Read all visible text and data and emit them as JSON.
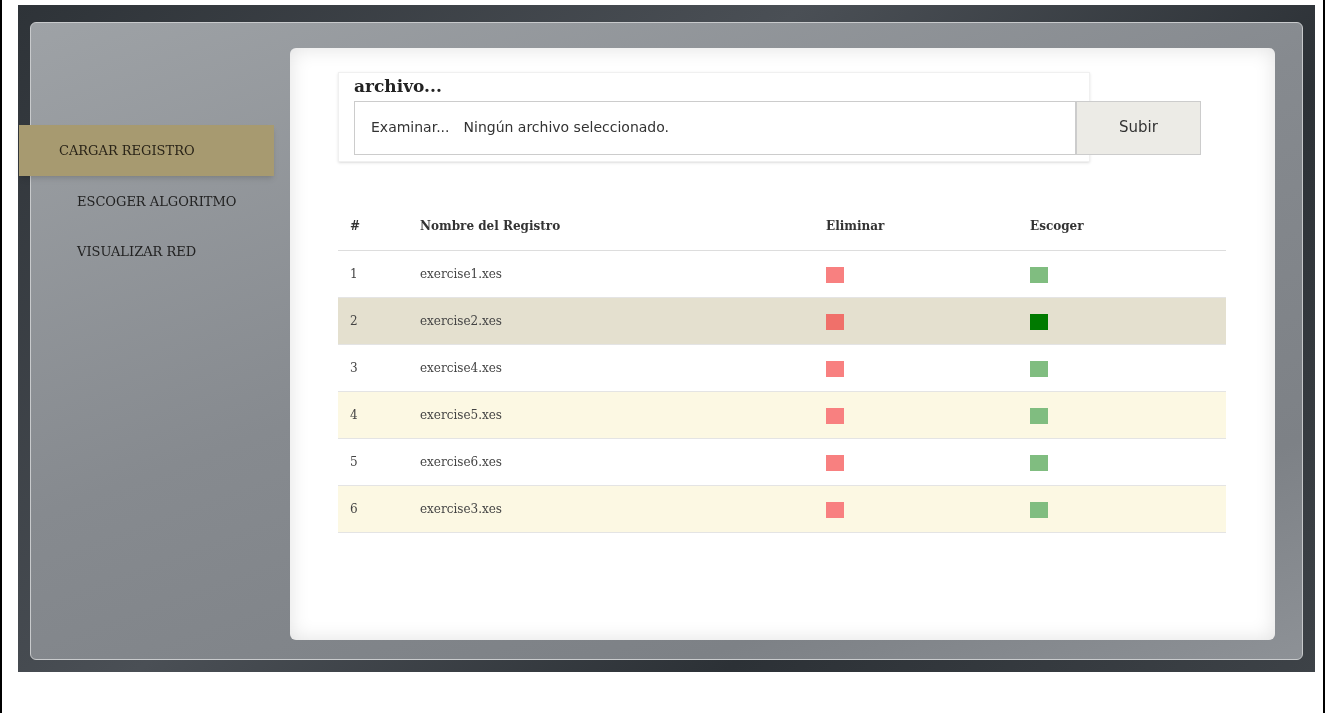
{
  "sidebar": {
    "items": [
      {
        "label": "CARGAR REGISTRO",
        "selected": true
      },
      {
        "label": "ESCOGER ALGORITMO",
        "selected": false
      },
      {
        "label": "VISUALIZAR RED",
        "selected": false
      }
    ]
  },
  "upload": {
    "label": "archivo...",
    "browse_button": "Examinar...",
    "file_status": "Ningún archivo seleccionado.",
    "submit_button": "Subir"
  },
  "table": {
    "columns": [
      "#",
      "Nombre del Registro",
      "Eliminar",
      "Escoger"
    ],
    "rows": [
      {
        "number": "1",
        "name": "exercise1.xes",
        "selected": false
      },
      {
        "number": "2",
        "name": "exercise2.xes",
        "selected": true
      },
      {
        "number": "3",
        "name": "exercise4.xes",
        "selected": false
      },
      {
        "number": "4",
        "name": "exercise5.xes",
        "selected": false
      },
      {
        "number": "5",
        "name": "exercise6.xes",
        "selected": false
      },
      {
        "number": "6",
        "name": "exercise3.xes",
        "selected": false
      }
    ]
  }
}
